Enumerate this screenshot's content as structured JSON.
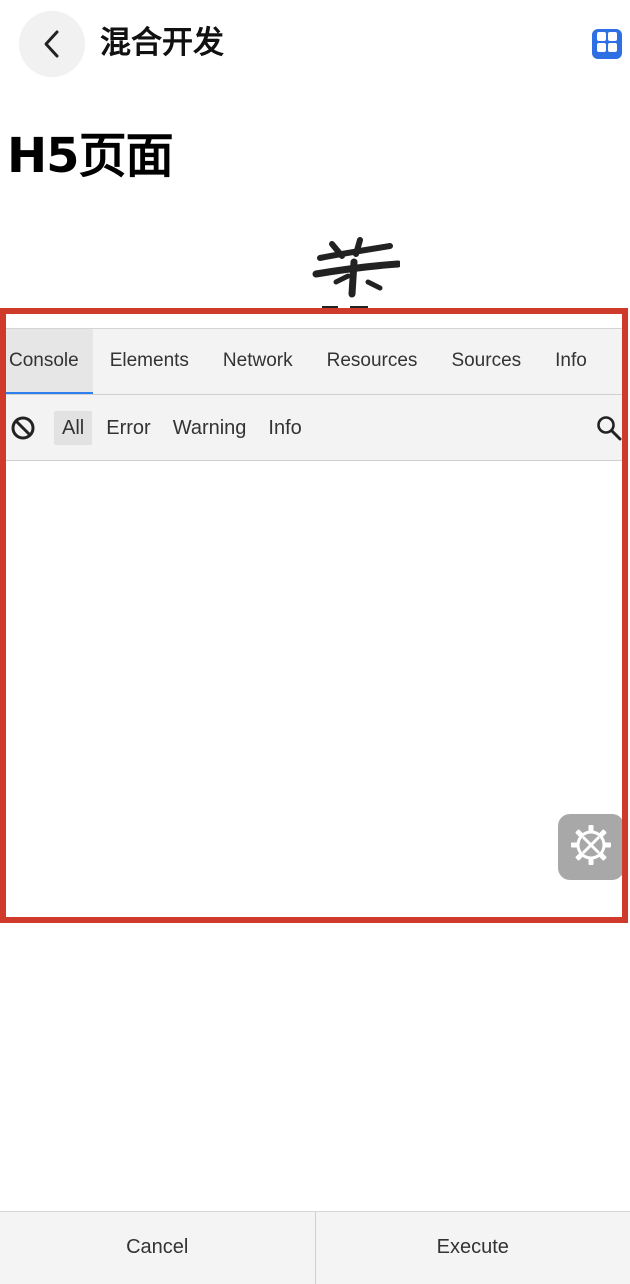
{
  "header": {
    "title": "混合开发",
    "back_icon": "chevron-left-icon",
    "apps_icon": "grid-icon",
    "accent_color": "#2f6fe4"
  },
  "content": {
    "heading": "H5页面"
  },
  "devtools": {
    "border_color": "#cf3a2b",
    "tabs": [
      {
        "label": "Console",
        "active": true
      },
      {
        "label": "Elements",
        "active": false
      },
      {
        "label": "Network",
        "active": false
      },
      {
        "label": "Resources",
        "active": false
      },
      {
        "label": "Sources",
        "active": false
      },
      {
        "label": "Info",
        "active": false
      }
    ],
    "filters": [
      {
        "label": "All",
        "active": true
      },
      {
        "label": "Error",
        "active": false
      },
      {
        "label": "Warning",
        "active": false
      },
      {
        "label": "Info",
        "active": false
      }
    ],
    "clear_icon": "block-icon",
    "search_icon": "search-icon",
    "settings_icon": "gear-wrench-icon"
  },
  "actions": {
    "cancel_label": "Cancel",
    "execute_label": "Execute"
  }
}
